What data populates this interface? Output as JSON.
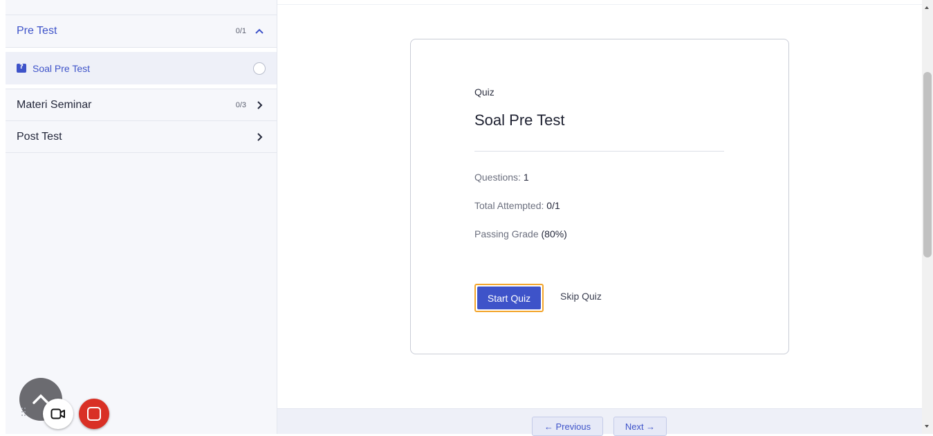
{
  "sidebar": {
    "sections": [
      {
        "title": "Pre Test",
        "count": "0/1",
        "state": "expanded",
        "chevron_icon": "chevron-up-icon"
      },
      {
        "title": "Materi Seminar",
        "count": "0/3",
        "state": "collapsed",
        "chevron_icon": "chevron-right-icon"
      },
      {
        "title": "Post Test",
        "count": "",
        "state": "collapsed",
        "chevron_icon": "chevron-right-icon"
      }
    ],
    "active_lesson": {
      "title": "Soal Pre Test",
      "icon": "quiz-icon",
      "status_icon": "incomplete-circle-icon"
    }
  },
  "quiz_card": {
    "label": "Quiz",
    "title": "Soal Pre Test",
    "questions_label": "Questions: ",
    "questions_value": "1",
    "attempted_label": "Total Attempted: ",
    "attempted_value": "0/1",
    "passing_label": "Passing Grade ",
    "passing_value": "(80%)",
    "start_button": "Start Quiz",
    "skip_button": "Skip Quiz"
  },
  "footer_nav": {
    "previous": "← Previous",
    "next": "Next →"
  },
  "recorder": {
    "icons": [
      "chevron-up-icon",
      "drag-handle-icon",
      "camera-icon",
      "stop-icon"
    ]
  },
  "colors": {
    "accent": "#3e53c9",
    "focus_ring": "#f3a52b",
    "stop_button": "#d93025",
    "sidebar_bg": "#f6f7fb"
  }
}
